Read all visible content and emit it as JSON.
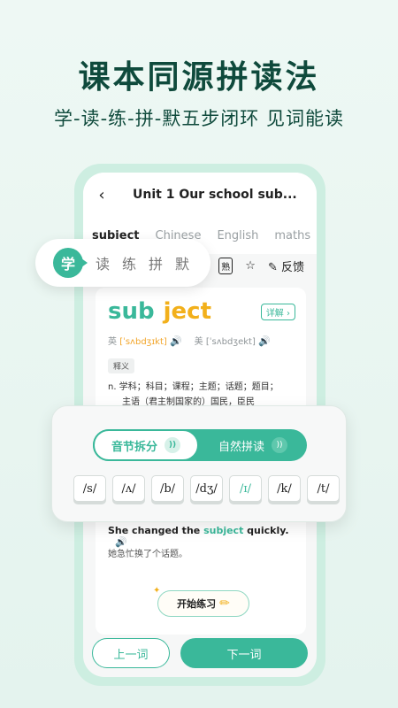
{
  "headline": "课本同源拼读法",
  "subline": "学-读-练-拼-默五步闭环  见词能读",
  "topbar": {
    "back_icon": "‹",
    "title": "Unit 1 Our school sub..."
  },
  "tabs": [
    "subject",
    "Chinese",
    "English",
    "maths"
  ],
  "tools": {
    "familiar": "熟",
    "star_icon": "☆",
    "pencil_icon": "✎",
    "feedback": "反馈"
  },
  "steps": {
    "active": "学",
    "rest": [
      "读",
      "练",
      "拼",
      "默"
    ]
  },
  "word": {
    "part1": "sub",
    "part2": "ject",
    "detail": "详解 ›"
  },
  "phonetics": {
    "uk_label": "英",
    "uk_ipa": "[ˈsʌbdʒɪkt]",
    "us_label": "美",
    "us_ipa": "[ˈsʌbdʒekt]",
    "speaker_icon": "🔊"
  },
  "tag": "释义",
  "definition": {
    "line1": "n. 学科；科目；课程；主题；话题；题目；",
    "line2": "主语（君主制国家的）国民，臣民"
  },
  "phonics": {
    "mode_left": "音节拆分",
    "mode_right": "自然拼读",
    "sound_icon": "))",
    "chips": [
      "/s/",
      "/ʌ/",
      "/b/",
      "/dʒ/",
      "/ɪ/",
      "/k/",
      "/t/"
    ]
  },
  "example": {
    "pre": "She changed the ",
    "hl": "subject",
    "post": " quickly.",
    "speaker_icon": "🔊",
    "cn": "她急忙换了个话题。"
  },
  "practice": {
    "label": "开始练习",
    "pencil_icon": "✏",
    "sparkle_icon": "✦"
  },
  "nav": {
    "prev": "上一词",
    "next": "下一词"
  },
  "colors": {
    "accent": "#3ab89a",
    "highlight": "#f2b01b",
    "dark": "#0f4a3c"
  }
}
